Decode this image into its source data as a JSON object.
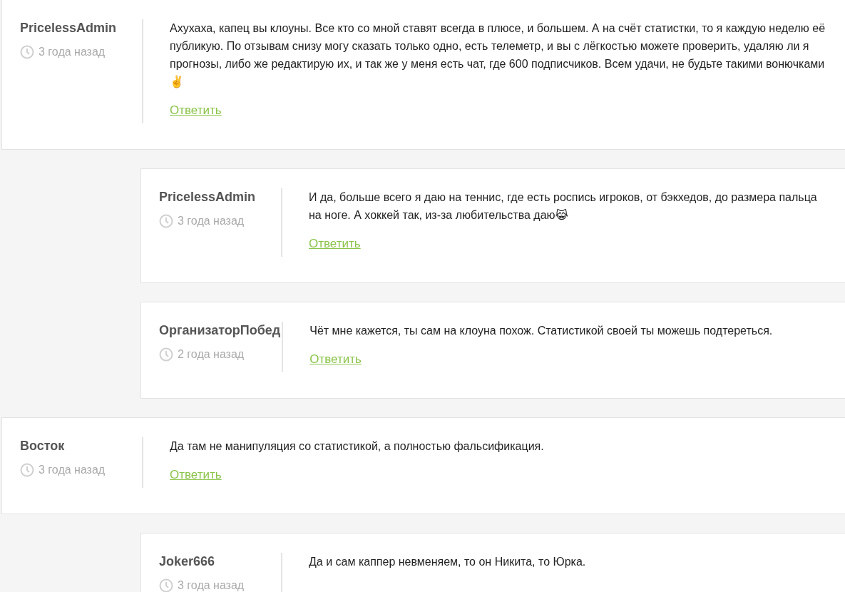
{
  "comments": [
    {
      "author": "PricelessAdmin",
      "time": "3 года назад",
      "text": "Ахухаха, капец вы клоуны. Все кто со мной ставят всегда в плюсе, и большем. А на счёт статистки, то я каждую неделю её публикую. По отзывам снизу могу сказать только одно, есть телеметр, и вы с лёгкостью можете проверить, удаляю ли я прогнозы, либо же редактирую их, и так же у меня есть чат, где 600 подписчиков. Всем удачи, не будьте такими вонючками✌️",
      "reply_label": "Ответить",
      "replies": [
        {
          "author": "PricelessAdmin",
          "time": "3 года назад",
          "text": "И да, больше всего я даю на теннис, где есть роспись игроков, от бэкхедов, до размера пальца на ноге. А хоккей так, из-за любительства даю😹",
          "reply_label": "Ответить"
        },
        {
          "author": "ОрганизаторПобед",
          "time": "2 года назад",
          "text": "Чёт мне кажется, ты сам на клоуна похож. Статистикой своей ты можешь подтереться.",
          "reply_label": "Ответить"
        }
      ]
    },
    {
      "author": "Восток",
      "time": "3 года назад",
      "text": "Да там не манипуляция со статистикой, а полностью фальсификация.",
      "reply_label": "Ответить",
      "replies": [
        {
          "author": "Joker666",
          "time": "3 года назад",
          "text": "Да и сам каппер невменяем, то он Никита, то Юрка."
        }
      ]
    }
  ]
}
